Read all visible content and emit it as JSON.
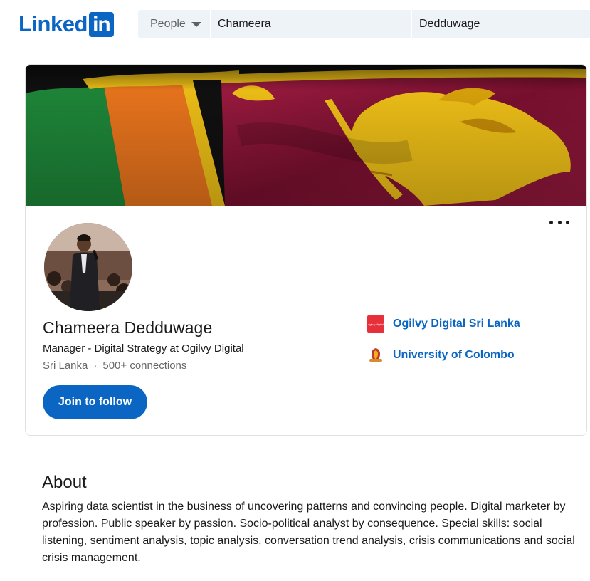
{
  "brand": {
    "logo_text": "Linked",
    "logo_box": "in",
    "color": "#0a66c2"
  },
  "search": {
    "type_label": "People",
    "first_name_value": "Chameera",
    "last_name_value": "Dedduwage"
  },
  "profile": {
    "cover_description": "Sri Lanka flag",
    "name": "Chameera Dedduwage",
    "headline": "Manager - Digital Strategy at Ogilvy Digital",
    "location": "Sri Lanka",
    "separator": "·",
    "connections": "500+ connections",
    "follow_label": "Join to follow",
    "company": {
      "name": "Ogilvy Digital Sri Lanka",
      "logo_text": "ogilvy digital",
      "icon": "ogilvy-logo-icon"
    },
    "school": {
      "name": "University of Colombo",
      "icon": "university-crest-icon"
    }
  },
  "about": {
    "title": "About",
    "text": "Aspiring data scientist in the business of uncovering patterns and convincing people. Digital marketer by profession. Public speaker by passion. Socio-political analyst by consequence. Special skills: social listening, sentiment analysis, topic analysis, conversation trend analysis, crisis communications and social crisis management."
  },
  "colors": {
    "accent": "#0a66c2",
    "flag_maroon": "#8d1538",
    "flag_gold": "#f5c518",
    "flag_green": "#1f8a3a",
    "flag_orange": "#f0781e"
  }
}
